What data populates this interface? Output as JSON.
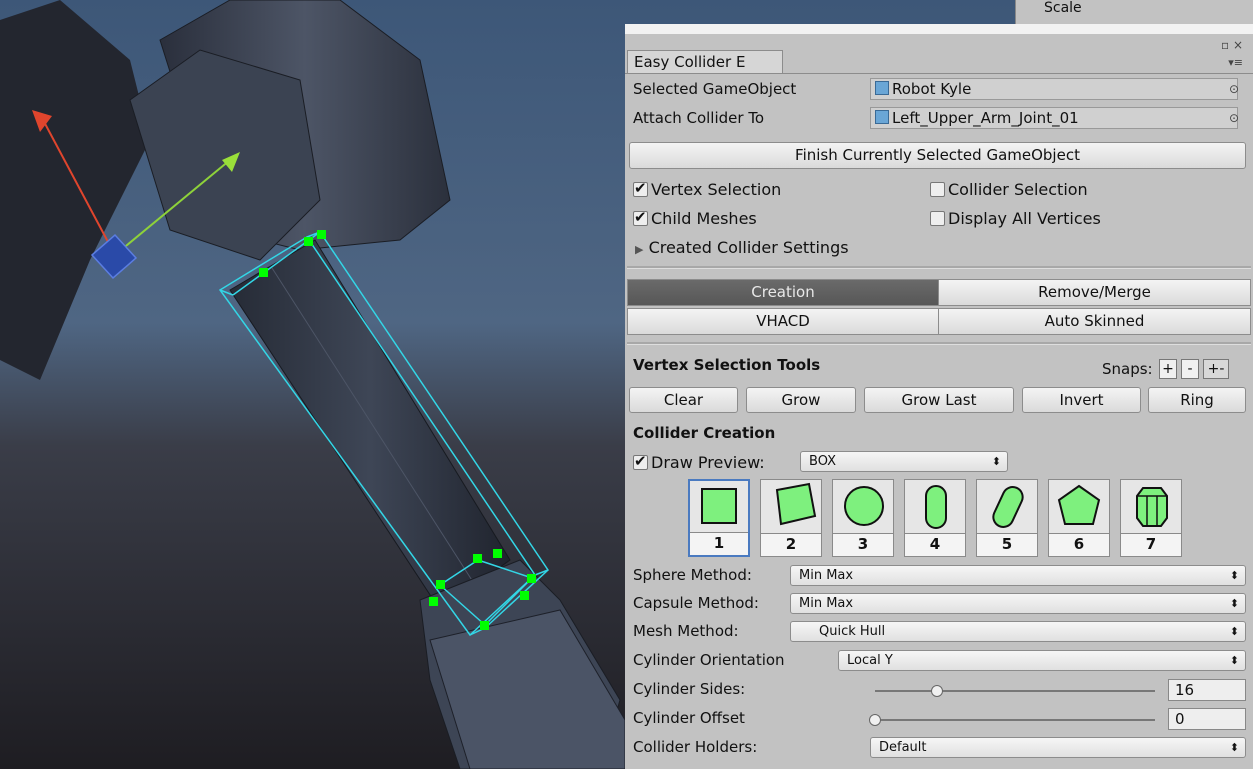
{
  "inspector": {
    "scale_label": "Scale"
  },
  "window": {
    "tab_title": "Easy Collider E",
    "close_icon": "×",
    "maximize_icon": "▫",
    "menu_icon": "▾≡"
  },
  "fields": {
    "selected_label": "Selected GameObject",
    "selected_value": "Robot Kyle",
    "attach_label": "Attach Collider To",
    "attach_value": "Left_Upper_Arm_Joint_01"
  },
  "finish_button": "Finish Currently Selected GameObject",
  "toggles": {
    "vertex_selection": "Vertex Selection",
    "collider_selection": "Collider Selection",
    "child_meshes": "Child Meshes",
    "display_all_vertices": "Display All Vertices",
    "created_settings": "Created Collider Settings"
  },
  "modes": [
    "Creation",
    "Remove/Merge",
    "VHACD",
    "Auto Skinned"
  ],
  "vertex_tools": {
    "heading": "Vertex Selection Tools",
    "snaps_label": "Snaps:",
    "snap_buttons": [
      "+",
      "-",
      "+-"
    ],
    "buttons": [
      "Clear",
      "Grow",
      "Grow Last",
      "Invert",
      "Ring"
    ]
  },
  "collider_creation": {
    "heading": "Collider Creation",
    "draw_preview_label": "Draw Preview:",
    "draw_preview_value": "BOX",
    "shapes": [
      "1",
      "2",
      "3",
      "4",
      "5",
      "6",
      "7"
    ],
    "shape_icons": [
      "box-icon",
      "rotated-box-icon",
      "sphere-icon",
      "capsule-icon",
      "rotated-capsule-icon",
      "convex-mesh-icon",
      "cylinder-icon"
    ]
  },
  "methods": {
    "sphere_label": "Sphere Method:",
    "sphere_value": "Min Max",
    "capsule_label": "Capsule Method:",
    "capsule_value": "Min Max",
    "mesh_label": "Mesh Method:",
    "mesh_value": "Quick Hull",
    "cyl_orient_label": "Cylinder Orientation",
    "cyl_orient_value": "Local Y",
    "cyl_sides_label": "Cylinder Sides:",
    "cyl_sides_value": "16",
    "cyl_sides_fraction": 0.22,
    "cyl_offset_label": "Cylinder Offset",
    "cyl_offset_value": "0",
    "cyl_offset_fraction": 0,
    "holders_label": "Collider Holders:",
    "holders_value": "Default"
  },
  "colors": {
    "panel_bg": "#c2c2c2",
    "active_tab": "#5f5f5f",
    "shape_fill": "#7ef07e",
    "vertex_marker": "#00ff00",
    "wireframe": "#33d6e6"
  }
}
